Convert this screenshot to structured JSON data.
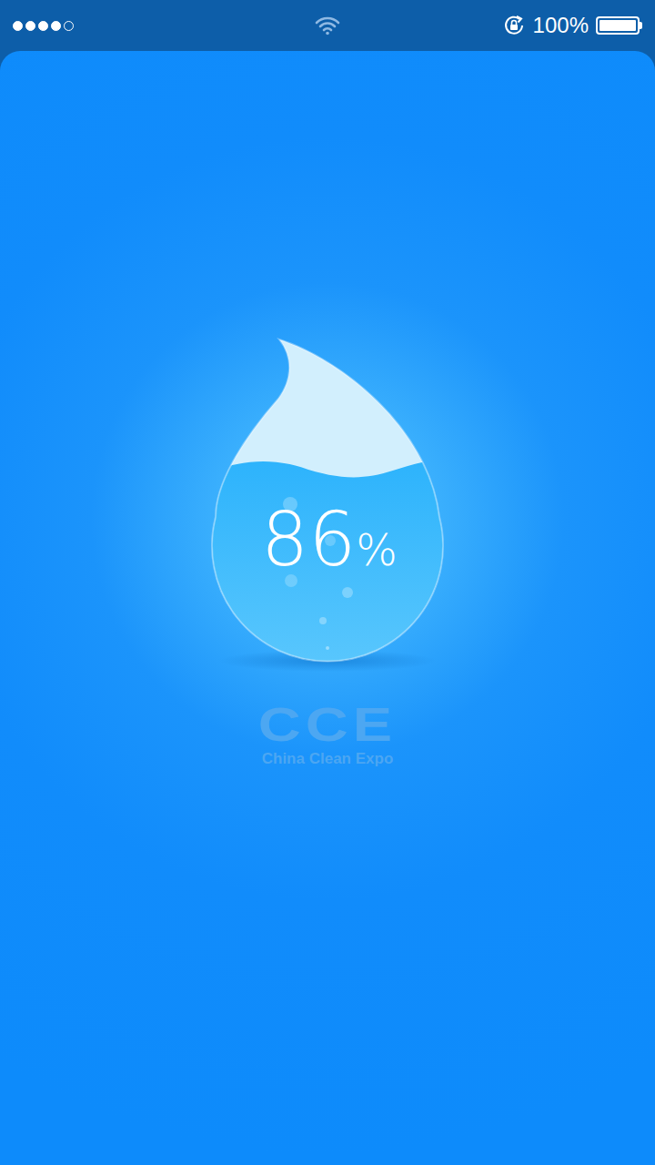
{
  "status_bar": {
    "signal_dots": [
      {
        "filled": true
      },
      {
        "filled": true
      },
      {
        "filled": true
      },
      {
        "filled": true
      },
      {
        "filled": false
      }
    ],
    "battery": {
      "reading": "100%",
      "level": 1.0
    }
  },
  "loader": {
    "value": "86",
    "unit": "%",
    "level": 0.86
  },
  "logo": {
    "mark": "CCE",
    "name": "China Clean Expo"
  }
}
